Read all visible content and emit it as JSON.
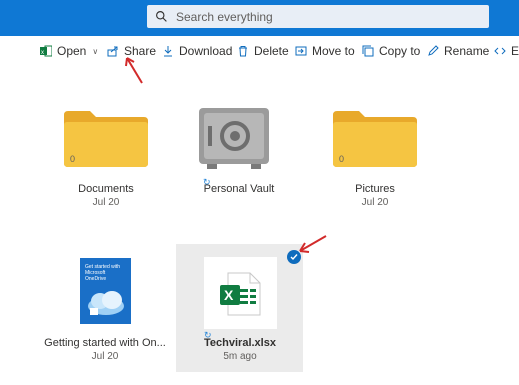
{
  "header": {
    "search_placeholder": "Search everything"
  },
  "toolbar": {
    "open_label": "Open",
    "share_label": "Share",
    "download_label": "Download",
    "delete_label": "Delete",
    "move_label": "Move to",
    "copy_label": "Copy to",
    "rename_label": "Rename",
    "embed_label": "Er"
  },
  "files": [
    {
      "name": "Documents",
      "meta": "Jul 20",
      "type": "folder",
      "count": "0"
    },
    {
      "name": "Personal Vault",
      "meta": "",
      "type": "vault"
    },
    {
      "name": "Pictures",
      "meta": "Jul 20",
      "type": "folder",
      "count": "0"
    },
    {
      "name": "Getting started with On...",
      "meta": "Jul 20",
      "type": "pdf",
      "thumb_text": "Get started with Microsoft OneDrive"
    },
    {
      "name": "Techviral.xlsx",
      "meta": "5m ago",
      "type": "xlsx",
      "selected": true
    }
  ],
  "colors": {
    "brand_blue": "#0f78d4",
    "folder_yellow": "#f5c542",
    "excel_green": "#107c41",
    "annotation_red": "#d22b2b"
  }
}
